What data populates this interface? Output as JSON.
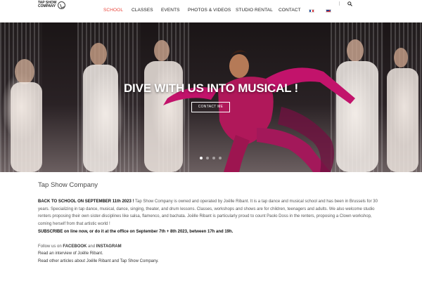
{
  "logo": {
    "text_line1": "TAP SHOW",
    "text_line2": "COMPANY"
  },
  "nav": {
    "items": [
      {
        "label": "SCHOOL",
        "active": true
      },
      {
        "label": "CLASSES",
        "active": false
      },
      {
        "label": "EVENTS",
        "active": false
      },
      {
        "label": "PHOTOS & VIDEOS",
        "active": false
      },
      {
        "label": "STUDIO RENTAL",
        "active": false
      },
      {
        "label": "CONTACT",
        "active": false
      }
    ],
    "languages": [
      "fr",
      "en"
    ],
    "search_icon": "search-icon"
  },
  "hero": {
    "title": "DIVE WITH US INTO MUSICAL !",
    "button_label": "CONTACT ME",
    "slides": 4,
    "active_slide": 1
  },
  "content": {
    "section_title": "Tap Show Company",
    "p1_strong": "BACK TO SCHOOL ON SEPTEMBER 11th 2023 !",
    "p1_text": " Tap Show Company is owned and operated by Joëlle Ribant. It is a tap dance and musical school and has been in Brussels for 30 years. Specializing in tap dance, musical, dance, singing, theater,  and drum lessons. Classes, workshops and shows are for children, teenagers and adults. We also welcome studio renters proposing their own sister-disciplines like salsa, flamenco, and bachata. Joëlle Ribant is particularly proud to count Paolo Doss in the renters, proposing a Clown workshop, coming herself from that artistic world !",
    "p2_strong": "SUBSCRIBE on line now, or do it at the office on September 7th + 8th 2023, between 17h and 19h.",
    "follow_prefix": "Follow us on ",
    "follow_facebook": "FACEBOOK",
    "follow_and": " and ",
    "follow_instagram": "INSTAGRAM",
    "link_interview": "Read an interview of Joëlle Ribant.",
    "link_articles": "Read other articles about Joëlle Ribant and Tap Show Company."
  },
  "colors": {
    "accent": "#e8463c",
    "text": "#555555",
    "heading": "#4a4a4a"
  }
}
